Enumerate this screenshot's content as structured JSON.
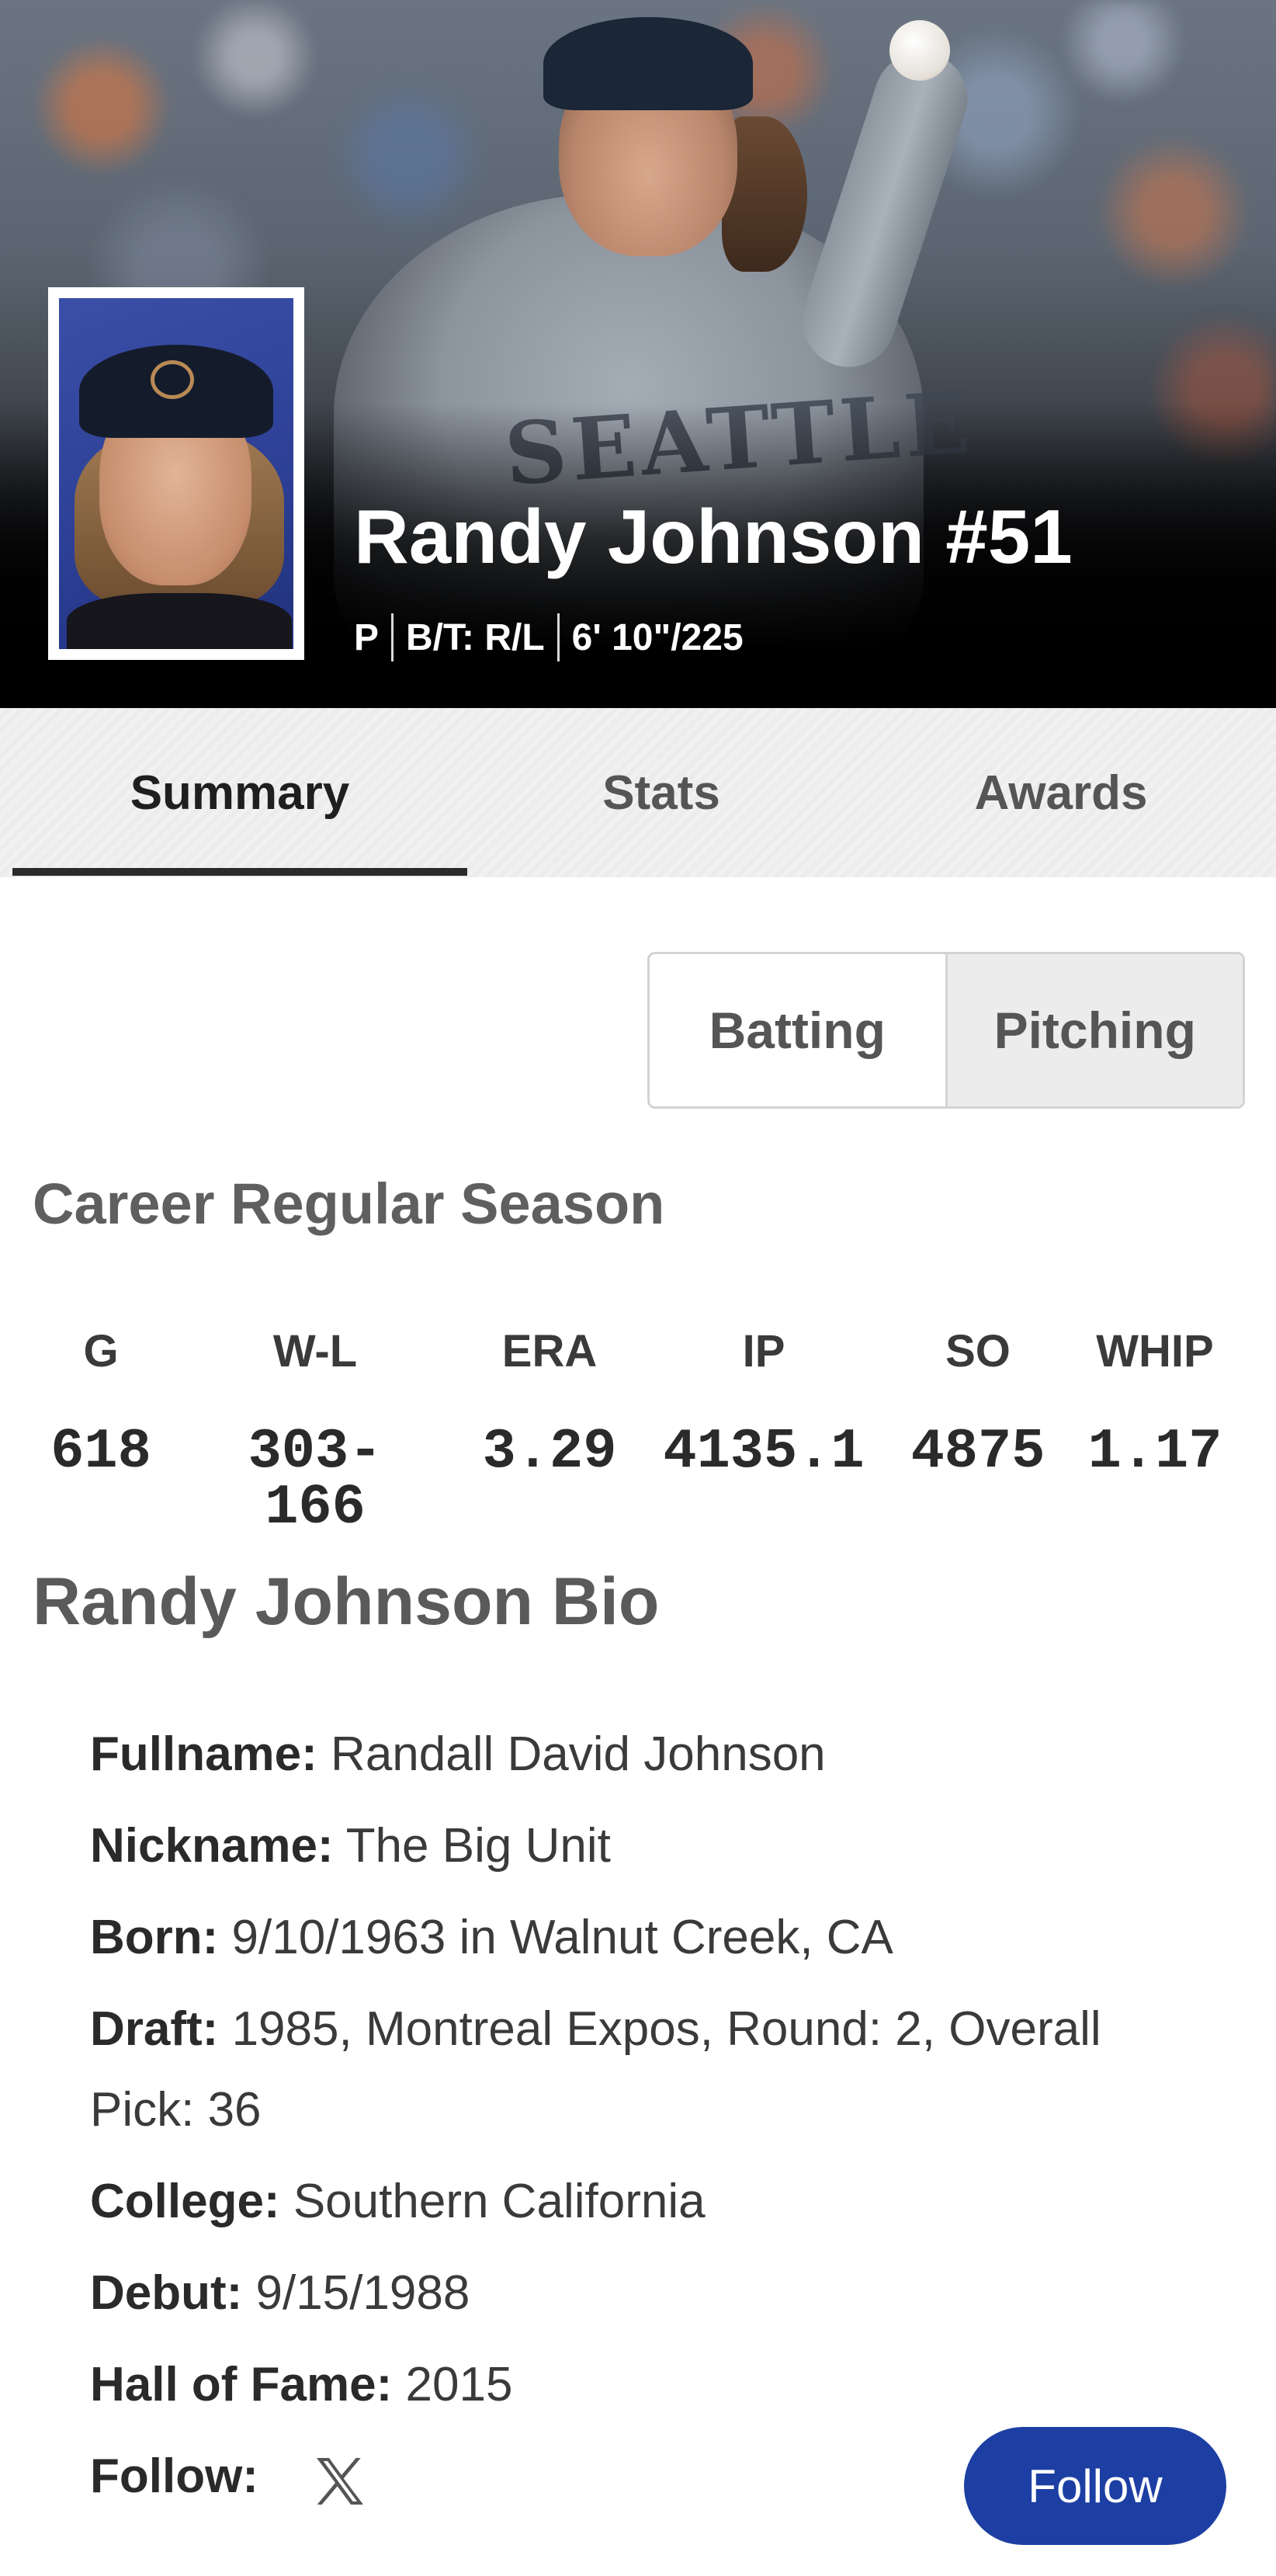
{
  "player": {
    "name": "Randy Johnson #51",
    "position": "P",
    "bats_throws": "B/T: R/L",
    "height_weight": "6' 10\"/225",
    "jersey_text": "SEATTLE"
  },
  "tabs": [
    {
      "label": "Summary",
      "active": true
    },
    {
      "label": "Stats",
      "active": false
    },
    {
      "label": "Awards",
      "active": false
    }
  ],
  "toggle": {
    "batting_label": "Batting",
    "pitching_label": "Pitching",
    "selected": "Pitching"
  },
  "career": {
    "title": "Career Regular Season",
    "columns": [
      {
        "label": "G",
        "value": "618"
      },
      {
        "label": "W-L",
        "value": "303-166"
      },
      {
        "label": "ERA",
        "value": "3.29"
      },
      {
        "label": "IP",
        "value": "4135.1"
      },
      {
        "label": "SO",
        "value": "4875"
      },
      {
        "label": "WHIP",
        "value": "1.17"
      }
    ]
  },
  "bio": {
    "title": "Randy Johnson Bio",
    "fullname_label": "Fullname:",
    "fullname": "Randall David Johnson",
    "nickname_label": "Nickname:",
    "nickname": "The Big Unit",
    "born_label": "Born:",
    "born": "9/10/1963 in Walnut Creek, CA",
    "draft_label": "Draft:",
    "draft": "1985, Montreal Expos, Round: 2, Overall Pick: 36",
    "college_label": "College:",
    "college": "Southern California",
    "debut_label": "Debut:",
    "debut": "9/15/1988",
    "hof_label": "Hall of Fame:",
    "hof": "2015",
    "follow_label": "Follow:",
    "follow_icon": "x-logo-icon",
    "follow_button": "Follow"
  },
  "colors": {
    "follow_button": "#1d3fa3",
    "active_tab_underline": "#2b2b2b"
  }
}
